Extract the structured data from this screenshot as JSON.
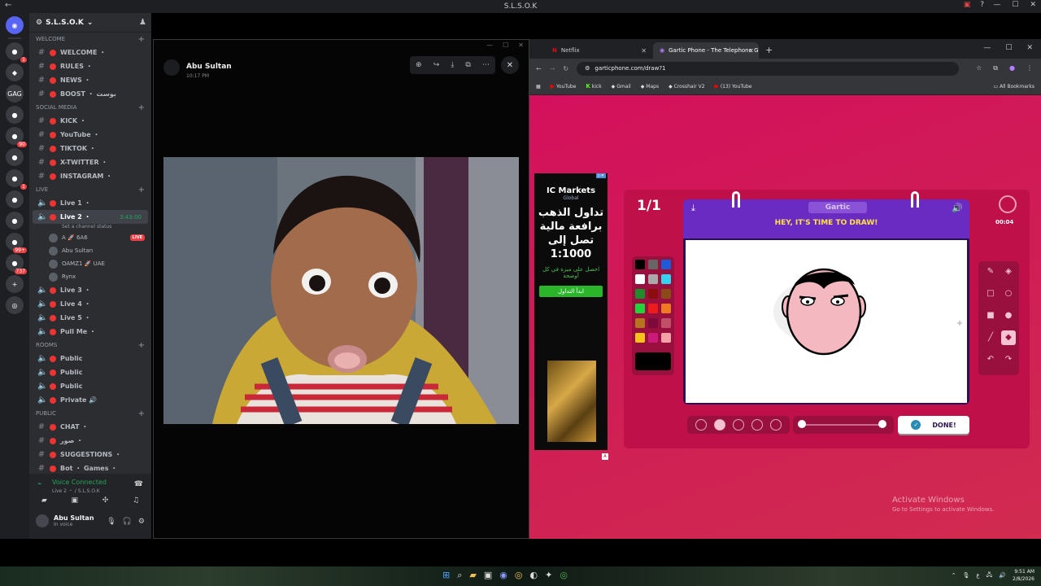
{
  "window": {
    "title": "S.L.S.O.K",
    "back": "←"
  },
  "server_rail": {
    "items": [
      {
        "name": "discord-home",
        "glyph": "◉",
        "badge": ""
      },
      {
        "name": "server-1",
        "glyph": "●",
        "badge": "1"
      },
      {
        "name": "server-2",
        "glyph": "◆",
        "badge": ""
      },
      {
        "name": "server-3",
        "glyph": "GAG",
        "badge": ""
      },
      {
        "name": "server-4",
        "glyph": "●",
        "badge": ""
      },
      {
        "name": "server-5",
        "glyph": "●",
        "badge": "90"
      },
      {
        "name": "server-6",
        "glyph": "●",
        "badge": ""
      },
      {
        "name": "server-7",
        "glyph": "●",
        "badge": "1"
      },
      {
        "name": "server-8",
        "glyph": "●",
        "badge": ""
      },
      {
        "name": "server-9",
        "glyph": "●",
        "badge": ""
      },
      {
        "name": "server-10",
        "glyph": "●",
        "badge": "99+"
      },
      {
        "name": "server-11",
        "glyph": "●",
        "badge": "737"
      }
    ]
  },
  "sidebar": {
    "server_name": "S.L.S.O.K",
    "categories": {
      "welcome": "WELCOME",
      "social": "Social Media",
      "live": "Live",
      "rooms": "ROOMS",
      "public": "PUBLIC"
    },
    "welcome_channels": [
      "WELCOME ・",
      "RULES ・",
      "NEWS ・",
      "BOOST ・ بوست"
    ],
    "social_channels": [
      "KICK ・",
      "YouTube ・",
      "TIKTOK ・",
      "X-TWITTER ・",
      "INSTAGRAM ・"
    ],
    "live_channels": {
      "live1": "Live 1 ・",
      "live2": "Live 2 ・",
      "live2_time": "3:43:00",
      "live2_status": "Set a channel status",
      "users": [
        {
          "name": "A 🚀 6A6",
          "live": "LIVE"
        },
        {
          "name": "Abu Sultan",
          "live": ""
        },
        {
          "name": "OAMZ1 🚀 UAE",
          "live": ""
        },
        {
          "name": "Rynx",
          "live": ""
        }
      ],
      "more": [
        "Live 3 ・",
        "Live 4 ・",
        "Live 5 ・",
        "Pull Me ・"
      ]
    },
    "room_channels": [
      "Public",
      "Public",
      "Public",
      "Private 🔊"
    ],
    "public_channels": [
      "CHAT ・",
      "صور ・",
      "SUGGESTIONS ・",
      "Bot ・ Games ・"
    ]
  },
  "voice": {
    "status": "Voice Connected",
    "channel": "Live 2 ・ / S.L.S.O.K",
    "user": "Abu Sultan",
    "user_status": "In voice"
  },
  "dm": {
    "sender": "Abu Sultan",
    "time": "10:17 PM"
  },
  "browser": {
    "tabs": [
      {
        "label": "Netflix",
        "active": false
      },
      {
        "label": "Gartic Phone - The Telephone G",
        "active": true
      }
    ],
    "url": "garticphone.com/draw?1",
    "bookmarks": [
      "YouTube",
      "kick",
      "Gmail",
      "Maps",
      "Crosshair V2",
      "(13) YouTube"
    ],
    "all_bookmarks": "All Bookmarks"
  },
  "ad": {
    "brand": "IC Markets",
    "brand_sub": "Global",
    "arabic_headline": "تداول الذهب برافعة مالية تصل إلى 1:1000",
    "arabic_sub": "احصل على ميزة في كل أوضحة",
    "cta": "ابدأ التداول"
  },
  "game": {
    "round": "1/1",
    "timer": "00:04",
    "logo": "Gartic",
    "prompt": "HEY, IT'S TIME TO DRAW!",
    "done": "DONE!",
    "palette": [
      "#000000",
      "#666666",
      "#1e5bd8",
      "#ffffff",
      "#aaaaaa",
      "#33d4f0",
      "#1e8c2c",
      "#8c0d0d",
      "#8a4a1a",
      "#21d43a",
      "#ee1b1b",
      "#f07a21",
      "#b5741d",
      "#7c0a3a",
      "#c0506a",
      "#f6c21a",
      "#cc1a7a",
      "#f4a2a8"
    ]
  },
  "watermark": {
    "title": "Activate Windows",
    "sub": "Go to Settings to activate Windows."
  },
  "clock": {
    "time": "9:51 AM",
    "date": "2/8/2026"
  }
}
